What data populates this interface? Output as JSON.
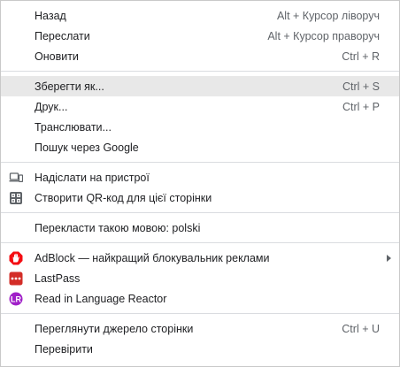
{
  "menu": {
    "back": {
      "label": "Назад",
      "shortcut": "Alt + Курсор ліворуч"
    },
    "forward": {
      "label": "Переслати",
      "shortcut": "Alt + Курсор праворуч"
    },
    "reload": {
      "label": "Оновити",
      "shortcut": "Ctrl + R"
    },
    "save_as": {
      "label": "Зберегти як...",
      "shortcut": "Ctrl + S"
    },
    "print": {
      "label": "Друк...",
      "shortcut": "Ctrl + P"
    },
    "cast": {
      "label": "Транслювати..."
    },
    "search_google": {
      "label": "Пошук через Google"
    },
    "send_to_devices": {
      "label": "Надіслати на пристрої",
      "icon": "devices-icon"
    },
    "qr_code": {
      "label": "Створити QR-код для цієї сторінки",
      "icon": "qr-code-icon"
    },
    "translate": {
      "label": "Перекласти такою мовою: polski"
    },
    "adblock": {
      "label": "AdBlock — найкращий блокувальник реклами",
      "icon": "adblock-icon",
      "color": "#f40d12"
    },
    "lastpass": {
      "label": "LastPass",
      "icon": "lastpass-icon",
      "color": "#d32d27"
    },
    "language_reactor": {
      "label": "Read in Language Reactor",
      "icon": "language-reactor-icon",
      "color": "#a020c8"
    },
    "view_source": {
      "label": "Переглянути джерело сторінки",
      "shortcut": "Ctrl + U"
    },
    "inspect": {
      "label": "Перевірити"
    }
  }
}
